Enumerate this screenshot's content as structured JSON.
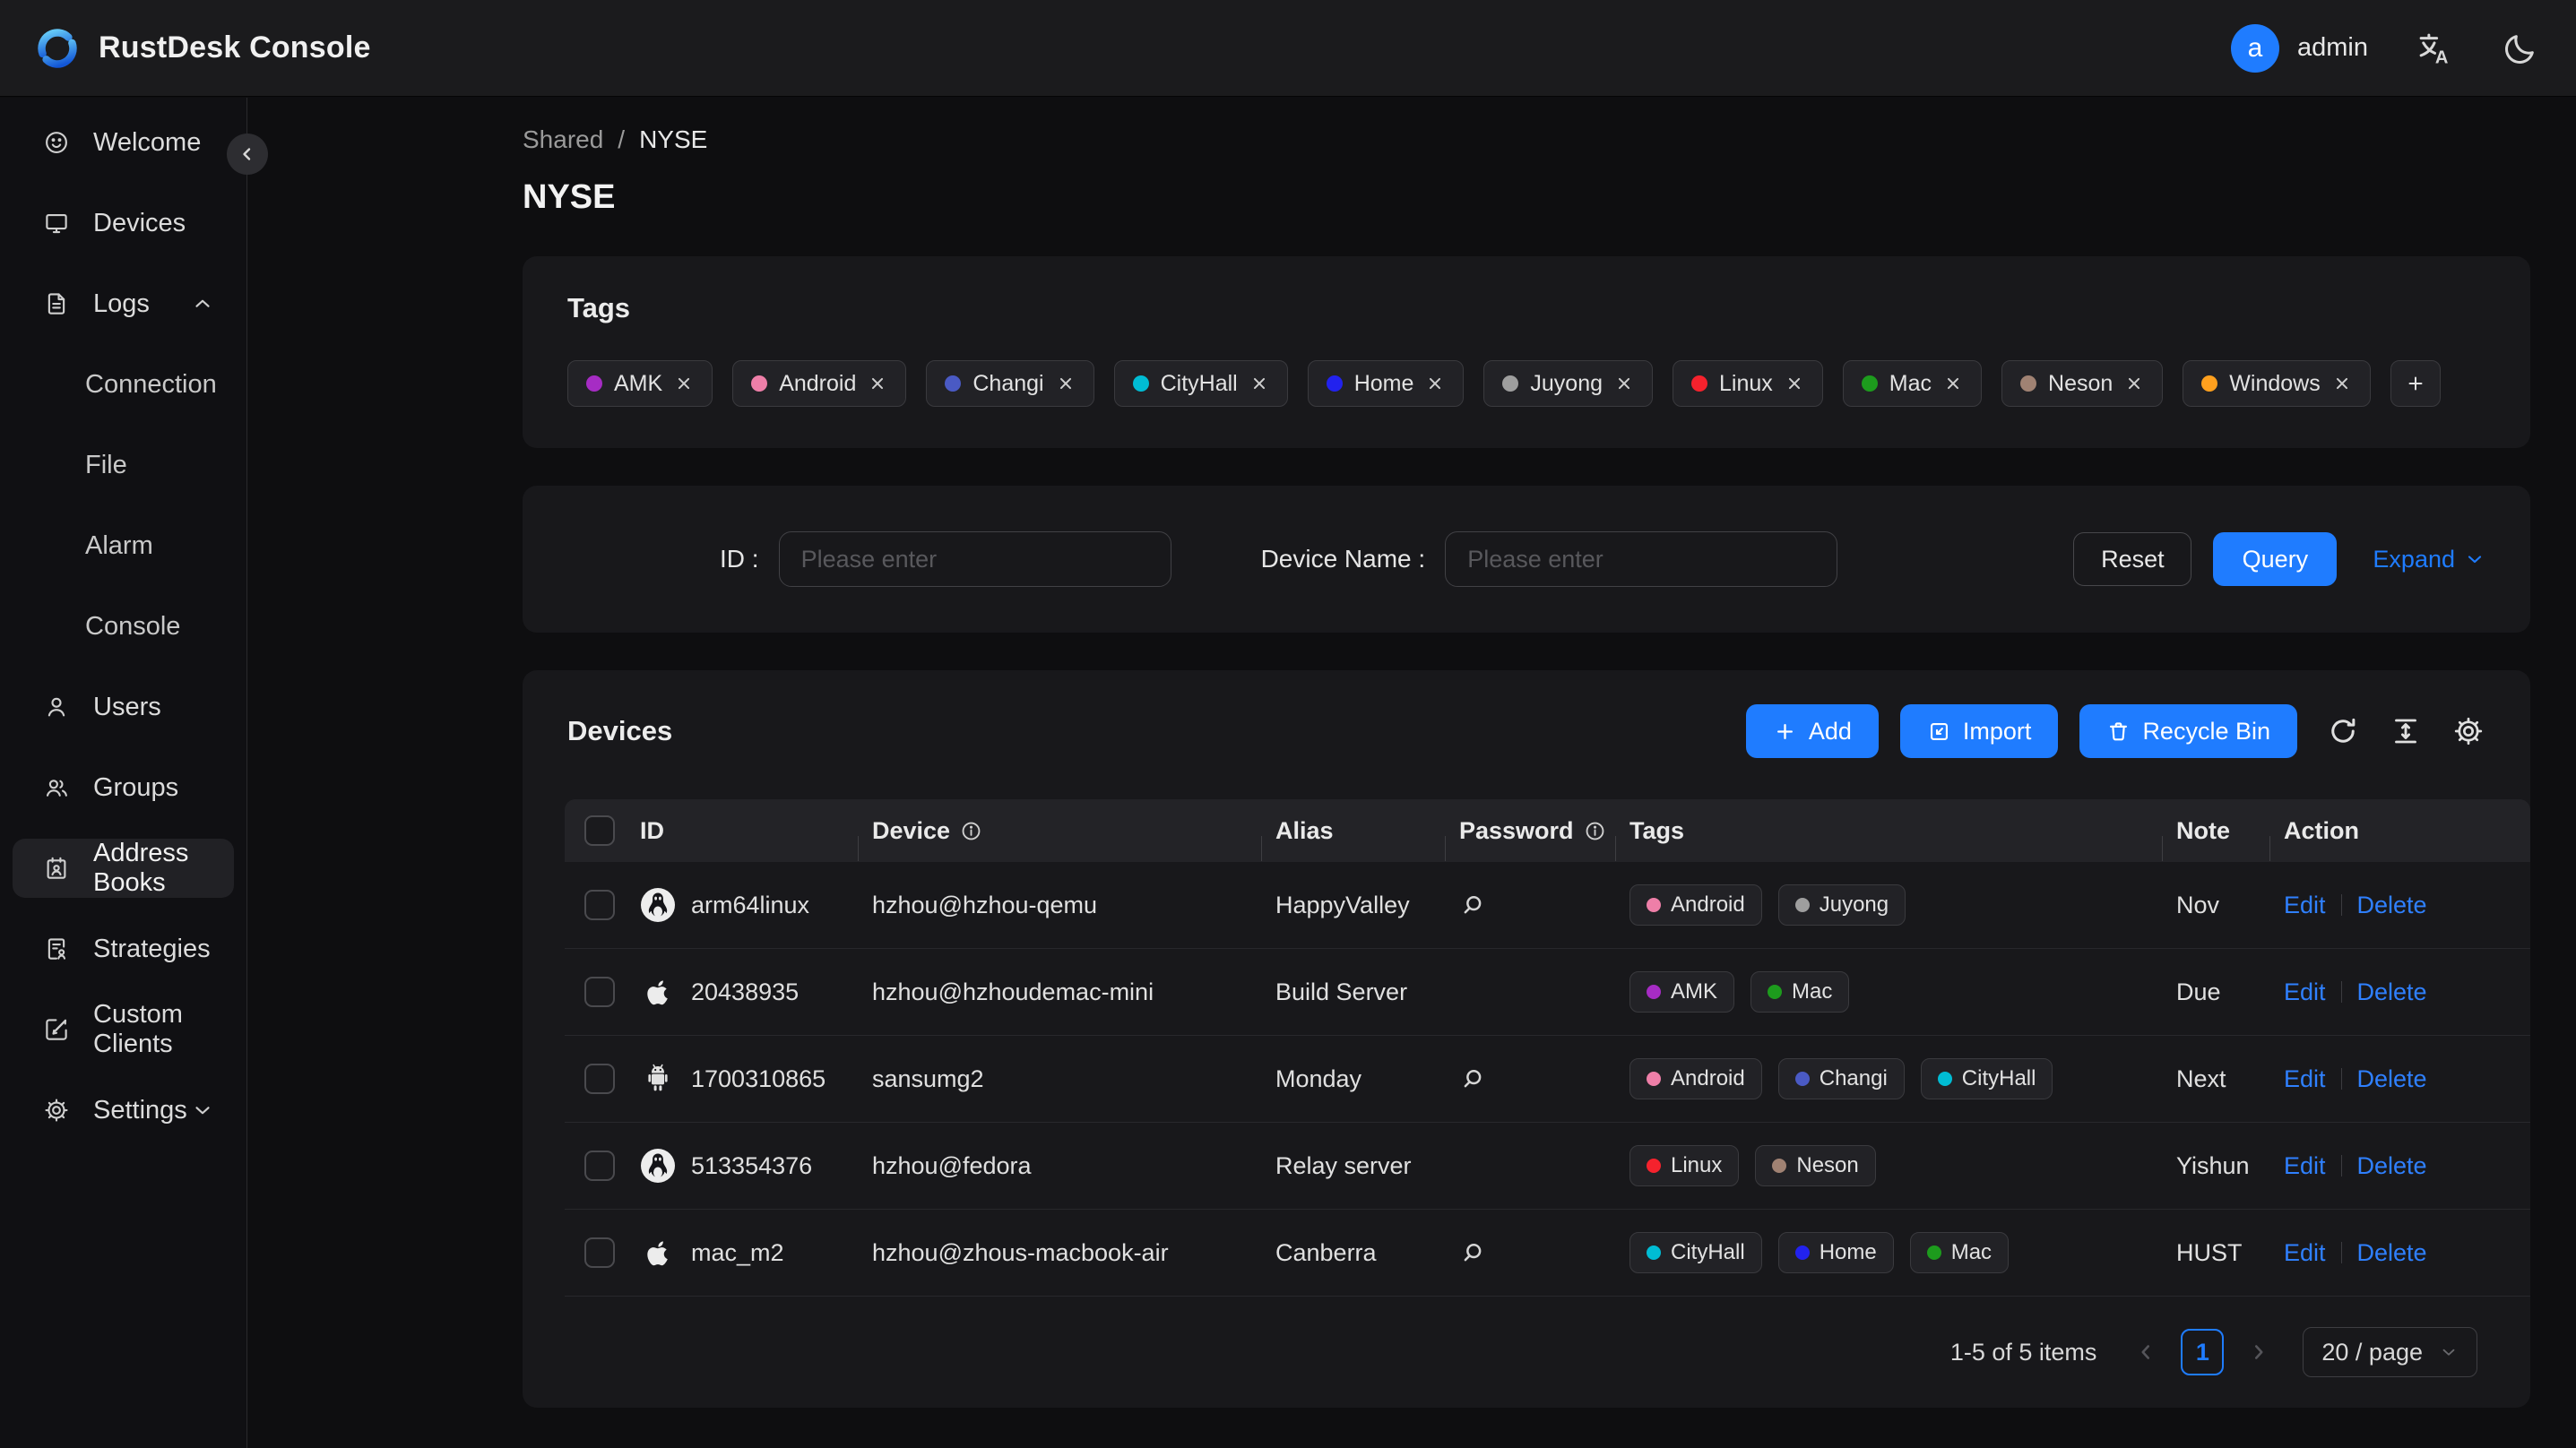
{
  "header": {
    "app_title": "RustDesk Console",
    "user": {
      "initial": "a",
      "name": "admin"
    }
  },
  "sidebar": {
    "welcome": "Welcome",
    "devices": "Devices",
    "logs": "Logs",
    "connection": "Connection",
    "file": "File",
    "alarm": "Alarm",
    "console": "Console",
    "users": "Users",
    "groups": "Groups",
    "address_books": "Address Books",
    "strategies": "Strategies",
    "custom_clients": "Custom Clients",
    "settings": "Settings",
    "active_item": "Address Books"
  },
  "breadcrumb": {
    "parent": "Shared",
    "separator": "/",
    "current": "NYSE"
  },
  "page_title": "NYSE",
  "tags_card": {
    "title": "Tags",
    "tags": [
      {
        "label": "AMK",
        "color": "#a62cc4"
      },
      {
        "label": "Android",
        "color": "#ee7fa8"
      },
      {
        "label": "Changi",
        "color": "#4a5ac4"
      },
      {
        "label": "CityHall",
        "color": "#00bcd4"
      },
      {
        "label": "Home",
        "color": "#2222ee"
      },
      {
        "label": "Juyong",
        "color": "#9e9e9e"
      },
      {
        "label": "Linux",
        "color": "#f5222d"
      },
      {
        "label": "Mac",
        "color": "#1d9b1d"
      },
      {
        "label": "Neson",
        "color": "#a08273"
      },
      {
        "label": "Windows",
        "color": "#ffa01e"
      }
    ],
    "add_label": "+"
  },
  "filter_card": {
    "id_label": "ID :",
    "id_placeholder": "Please enter",
    "device_name_label": "Device Name :",
    "device_name_placeholder": "Please enter",
    "reset_label": "Reset",
    "query_label": "Query",
    "expand_label": "Expand"
  },
  "devices_card": {
    "title": "Devices",
    "add_label": "Add",
    "import_label": "Import",
    "recycle_bin_label": "Recycle Bin",
    "table": {
      "columns": {
        "id": "ID",
        "device": "Device",
        "alias": "Alias",
        "password": "Password",
        "tags": "Tags",
        "note": "Note",
        "action": "Action"
      },
      "edit_label": "Edit",
      "delete_label": "Delete",
      "rows": [
        {
          "os": "linux",
          "id": "arm64linux",
          "device": "hzhou@hzhou-qemu",
          "alias": "HappyValley",
          "has_password": true,
          "tags": [
            {
              "label": "Android",
              "color": "#ee7fa8"
            },
            {
              "label": "Juyong",
              "color": "#9e9e9e"
            }
          ],
          "note": "Nov"
        },
        {
          "os": "apple",
          "id": "20438935",
          "device": "hzhou@hzhoudemac-mini",
          "alias": "Build Server",
          "has_password": false,
          "tags": [
            {
              "label": "AMK",
              "color": "#a62cc4"
            },
            {
              "label": "Mac",
              "color": "#1d9b1d"
            }
          ],
          "note": "Due"
        },
        {
          "os": "android",
          "id": "1700310865",
          "device": "sansumg2",
          "alias": "Monday",
          "has_password": true,
          "tags": [
            {
              "label": "Android",
              "color": "#ee7fa8"
            },
            {
              "label": "Changi",
              "color": "#4a5ac4"
            },
            {
              "label": "CityHall",
              "color": "#00bcd4"
            }
          ],
          "note": "Next"
        },
        {
          "os": "linux",
          "id": "513354376",
          "device": "hzhou@fedora",
          "alias": "Relay server",
          "has_password": false,
          "tags": [
            {
              "label": "Linux",
              "color": "#f5222d"
            },
            {
              "label": "Neson",
              "color": "#a08273"
            }
          ],
          "note": "Yishun"
        },
        {
          "os": "apple",
          "id": "mac_m2",
          "device": "hzhou@zhous-macbook-air",
          "alias": "Canberra",
          "has_password": true,
          "tags": [
            {
              "label": "CityHall",
              "color": "#00bcd4"
            },
            {
              "label": "Home",
              "color": "#2222ee"
            },
            {
              "label": "Mac",
              "color": "#1d9b1d"
            }
          ],
          "note": "HUST"
        }
      ]
    },
    "pagination": {
      "summary": "1-5 of 5 items",
      "page": "1",
      "page_size": "20 / page"
    }
  },
  "colors": {
    "accent_blue": "#1f7cff",
    "card_bg": "#18181b",
    "page_bg": "#0e0e10"
  }
}
